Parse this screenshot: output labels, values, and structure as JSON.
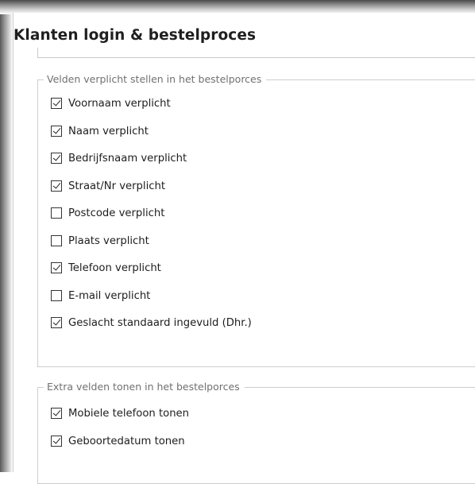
{
  "title": "Klanten login & bestelproces",
  "groups": [
    {
      "legend": "Velden verplicht stellen in het bestelporces",
      "options": [
        {
          "label": "Voornaam verplicht",
          "checked": true
        },
        {
          "label": "Naam verplicht",
          "checked": true
        },
        {
          "label": "Bedrijfsnaam verplicht",
          "checked": true
        },
        {
          "label": "Straat/Nr verplicht",
          "checked": true
        },
        {
          "label": "Postcode verplicht",
          "checked": false
        },
        {
          "label": "Plaats verplicht",
          "checked": false
        },
        {
          "label": "Telefoon verplicht",
          "checked": true
        },
        {
          "label": "E-mail verplicht",
          "checked": false
        },
        {
          "label": "Geslacht standaard ingevuld (Dhr.)",
          "checked": true
        }
      ]
    },
    {
      "legend": "Extra velden tonen in het bestelporces",
      "options": [
        {
          "label": "Mobiele telefoon tonen",
          "checked": true
        },
        {
          "label": "Geboortedatum tonen",
          "checked": true
        }
      ]
    }
  ]
}
